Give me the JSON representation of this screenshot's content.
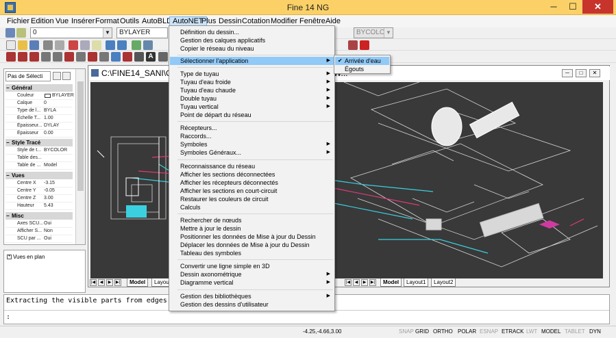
{
  "window": {
    "title": "Fine 14 NG",
    "minimize": "─",
    "maximize": "☐",
    "close": "✕"
  },
  "menubar": [
    "Fichier",
    "Edition",
    "Vue",
    "Insérer",
    "Format",
    "Outils",
    "AutoBLD",
    "AutoNET",
    "Plus",
    "Dessin",
    "Cotation",
    "Modifier",
    "Fenêtre",
    "Aide"
  ],
  "toolbar": {
    "layer_combo": "0",
    "linetype_combo": "BYLAYER",
    "color_combo": "BYCOLOR"
  },
  "properties": {
    "selector": "Pas de Sélecti",
    "sections": {
      "general": "Général",
      "style": "Style Tracé",
      "views": "Vues",
      "misc": "Misc"
    },
    "general_rows": [
      {
        "k": "Couleur",
        "v": "BYLAYER"
      },
      {
        "k": "Calque",
        "v": "0"
      },
      {
        "k": "Type de l...",
        "v": "BYLA"
      },
      {
        "k": "Échelle T...",
        "v": "1.00"
      },
      {
        "k": "Épaisseur...",
        "v": "DYLAY"
      },
      {
        "k": "Épaisseur",
        "v": "0.00"
      }
    ],
    "style_rows": [
      {
        "k": "Style de t...",
        "v": "BYCOLOR"
      },
      {
        "k": "Table des...",
        "v": ""
      },
      {
        "k": "Table de ...",
        "v": "Model"
      }
    ],
    "views_rows": [
      {
        "k": "Centre X",
        "v": "-3.15"
      },
      {
        "k": "Centre Y",
        "v": "-0.05"
      },
      {
        "k": "Centre Z",
        "v": "3.00"
      },
      {
        "k": "Hauteur",
        "v": "5.43"
      }
    ],
    "misc_rows": [
      {
        "k": "Axes SCU...",
        "v": "Oui"
      },
      {
        "k": "Afficher S...",
        "v": "Non"
      },
      {
        "k": "SCU par ...",
        "v": "Oui"
      }
    ]
  },
  "views_panel": {
    "item": "Vues en plan"
  },
  "drawing": {
    "title": "C:\\FINE14_SANI\\CALC\\Detached house.bld\\Detached house.DW...",
    "tabs": [
      "Model",
      "Layout1",
      "Layout2"
    ]
  },
  "command": {
    "line1": "Extracting the visible parts from edges...",
    "line2": ":"
  },
  "status": {
    "coords": "-4.25,-4.66,3.00",
    "buttons": [
      {
        "label": "SNAP",
        "on": false
      },
      {
        "label": "GRID",
        "on": true
      },
      {
        "label": "ORTHO",
        "on": true
      },
      {
        "label": "POLAR",
        "on": true
      },
      {
        "label": "ESNAP",
        "on": false
      },
      {
        "label": "ETRACK",
        "on": true
      },
      {
        "label": "LWT",
        "on": false
      },
      {
        "label": "MODEL",
        "on": true
      },
      {
        "label": "TABLET",
        "on": false
      },
      {
        "label": "DYN",
        "on": true
      }
    ]
  },
  "autonet_menu": {
    "groups": [
      [
        "Définition du dessin...",
        "Gestion des calques applicatifs",
        "Copier le réseau du niveau"
      ],
      [
        "Sélectionner l'application"
      ],
      [
        "Type de tuyau",
        "Tuyau d'eau froide",
        "Tuyau d'eau chaude",
        "Double tuyau",
        "Tuyau vertical",
        "Point de départ du réseau"
      ],
      [
        "Récepteurs...",
        "Raccords...",
        "Symboles",
        "Symboles Généraux..."
      ],
      [
        "Reconnaissance du réseau",
        "Afficher les sections déconnectées",
        "Afficher les récepteurs déconnectés",
        "Afficher les sections en court-circuit",
        "Restaurer les couleurs de circuit",
        "Calculs"
      ],
      [
        "Rechercher de nœuds",
        "Mettre à jour le dessin",
        "Positionner les données de Mise à jour du Dessin",
        "Déplacer les données de Mise à jour du Dessin",
        "Tableau des symboles"
      ],
      [
        "Convertir une ligne simple en 3D",
        "Dessin axonométrique",
        "Diagramme vertical"
      ],
      [
        "Gestion des bibliothèques",
        "Gestion des dessins d'utilisateur"
      ]
    ],
    "highlighted": "Sélectionner l'application",
    "submenu_items": [
      "Sélectionner l'application",
      "Type de tuyau",
      "Tuyau d'eau froide",
      "Tuyau d'eau chaude",
      "Double tuyau",
      "Tuyau vertical",
      "Symboles",
      "Symboles Généraux...",
      "Dessin axonométrique",
      "Diagramme vertical",
      "Gestion des bibliothèques"
    ]
  },
  "select_app_submenu": {
    "items": [
      "Arrivée d'eau",
      "Égouts"
    ],
    "checked": "Arrivée d'eau"
  },
  "colors": {
    "titlebar": "#fbd167",
    "menu_highlight": "#91c9f7",
    "canvas": "#393939",
    "close": "#c7342c"
  }
}
